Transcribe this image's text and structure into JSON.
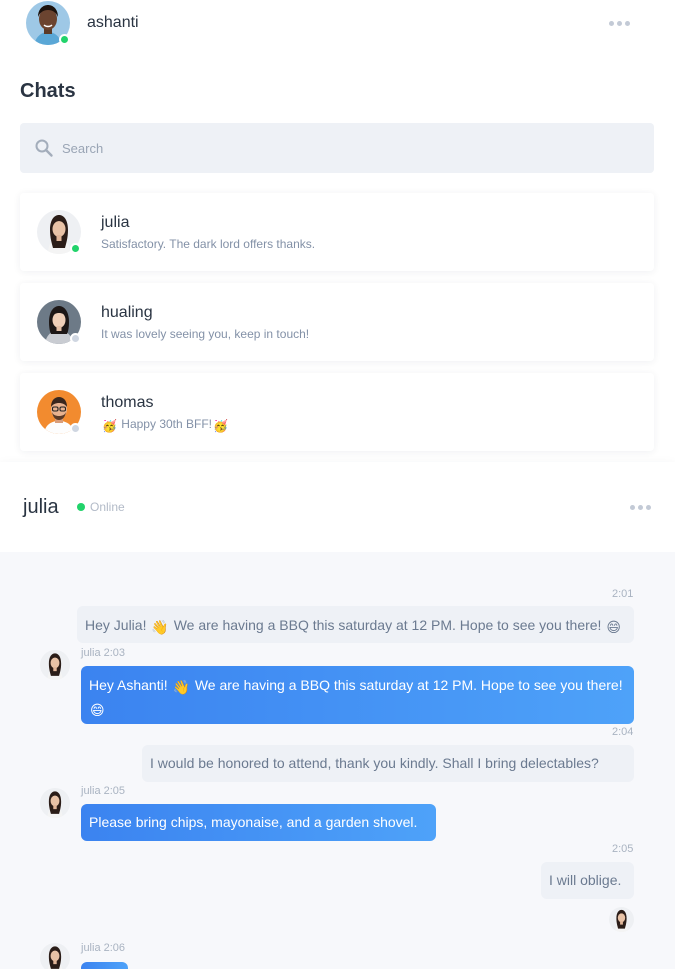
{
  "me": {
    "name": "ashanti"
  },
  "chats": {
    "title": "Chats",
    "search_placeholder": "Search",
    "items": [
      {
        "name": "julia",
        "preview": "Satisfactory. The dark lord offers thanks.",
        "status": "online"
      },
      {
        "name": "hualing",
        "preview": "It was lovely seeing you, keep in touch!",
        "status": "offline"
      },
      {
        "name": "thomas",
        "preview": "Happy 30th BFF!",
        "preview_emoji": "🥳",
        "status": "offline"
      }
    ]
  },
  "conversation": {
    "name": "julia",
    "status": "Online",
    "messages": [
      {
        "time": "2:01",
        "text_1": "Hey Julia!",
        "emoji_1": "👋",
        "text_2": "We are having a BBQ this saturday at 12 PM. Hope to see you there!",
        "emoji_2": "😄"
      },
      {
        "meta": "julia 2:03",
        "text_1": "Hey Ashanti!",
        "emoji_1": "👋",
        "text_2": "We are having a BBQ this saturday at 12 PM. Hope to see you there!",
        "emoji_2": "😄"
      },
      {
        "time": "2:04",
        "text": "I would be honored to attend, thank you kindly. Shall I bring delectables?"
      },
      {
        "meta": "julia 2:05",
        "text": "Please bring chips, mayonaise, and a garden shovel."
      },
      {
        "time": "2:05",
        "text": "I will oblige."
      },
      {
        "meta": "julia 2:06"
      }
    ]
  },
  "colors": {
    "accent": "#3b83f0",
    "online": "#22d36b",
    "offline": "#cfd6e1"
  }
}
